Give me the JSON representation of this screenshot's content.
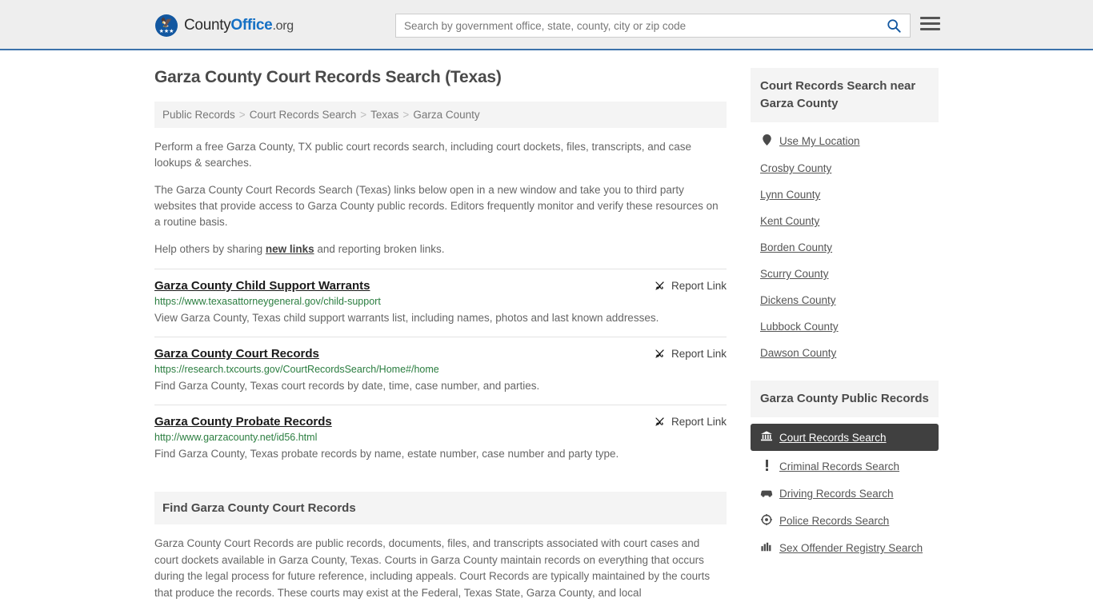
{
  "header": {
    "brand": {
      "part1": "County",
      "part2": "Office",
      "part3": ".org"
    },
    "search": {
      "placeholder": "Search by government office, state, county, city or zip code",
      "value": ""
    },
    "icons": {
      "search": "search-icon",
      "menu": "hamburger-menu-icon"
    },
    "accent_color": "#1570c4",
    "border_color": "#3b72ab"
  },
  "main": {
    "title": "Garza County Court Records Search (Texas)",
    "breadcrumb": [
      "Public Records",
      "Court Records Search",
      "Texas",
      "Garza County"
    ],
    "breadcrumb_separator": ">",
    "intro": {
      "p1": "Perform a free Garza County, TX public court records search, including court dockets, files, transcripts, and case lookups & searches.",
      "p2": "The Garza County Court Records Search (Texas) links below open in a new window and take you to third party websites that provide access to Garza County public records. Editors frequently monitor and verify these resources on a routine basis.",
      "p3_before": "Help others by sharing ",
      "p3_link": "new links",
      "p3_after": " and reporting broken links."
    },
    "report_link_label": "Report Link",
    "results": [
      {
        "title": "Garza County Child Support Warrants",
        "url": "https://www.texasattorneygeneral.gov/child-support",
        "description": "View Garza County, Texas child support warrants list, including names, photos and last known addresses."
      },
      {
        "title": "Garza County Court Records",
        "url": "https://research.txcourts.gov/CourtRecordsSearch/Home#/home",
        "description": "Find Garza County, Texas court records by date, time, case number, and parties."
      },
      {
        "title": "Garza County Probate Records",
        "url": "http://www.garzacounty.net/id56.html",
        "description": "Find Garza County, Texas probate records by name, estate number, case number and party type."
      }
    ],
    "section": {
      "heading": "Find Garza County Court Records",
      "body": "Garza County Court Records are public records, documents, files, and transcripts associated with court cases and court dockets available in Garza County, Texas. Courts in Garza County maintain records on everything that occurs during the legal process for future reference, including appeals. Court Records are typically maintained by the courts that produce the records. These courts may exist at the Federal, Texas State, Garza County, and local"
    }
  },
  "sidebar": {
    "nearby": {
      "heading": "Court Records Search near Garza County",
      "use_my_location": "Use My Location",
      "counties": [
        "Crosby County",
        "Lynn County",
        "Kent County",
        "Borden County",
        "Scurry County",
        "Dickens County",
        "Lubbock County",
        "Dawson County"
      ]
    },
    "public_records": {
      "heading": "Garza County Public Records",
      "items": [
        {
          "label": "Court Records Search",
          "icon": "courthouse-icon",
          "active": true
        },
        {
          "label": "Criminal Records Search",
          "icon": "exclamation-icon",
          "active": false
        },
        {
          "label": "Driving Records Search",
          "icon": "car-icon",
          "active": false
        },
        {
          "label": "Police Records Search",
          "icon": "badge-icon",
          "active": false
        },
        {
          "label": "Sex Offender Registry Search",
          "icon": "fingerprint-icon",
          "active": false
        }
      ],
      "active_bg": "#404040"
    }
  }
}
